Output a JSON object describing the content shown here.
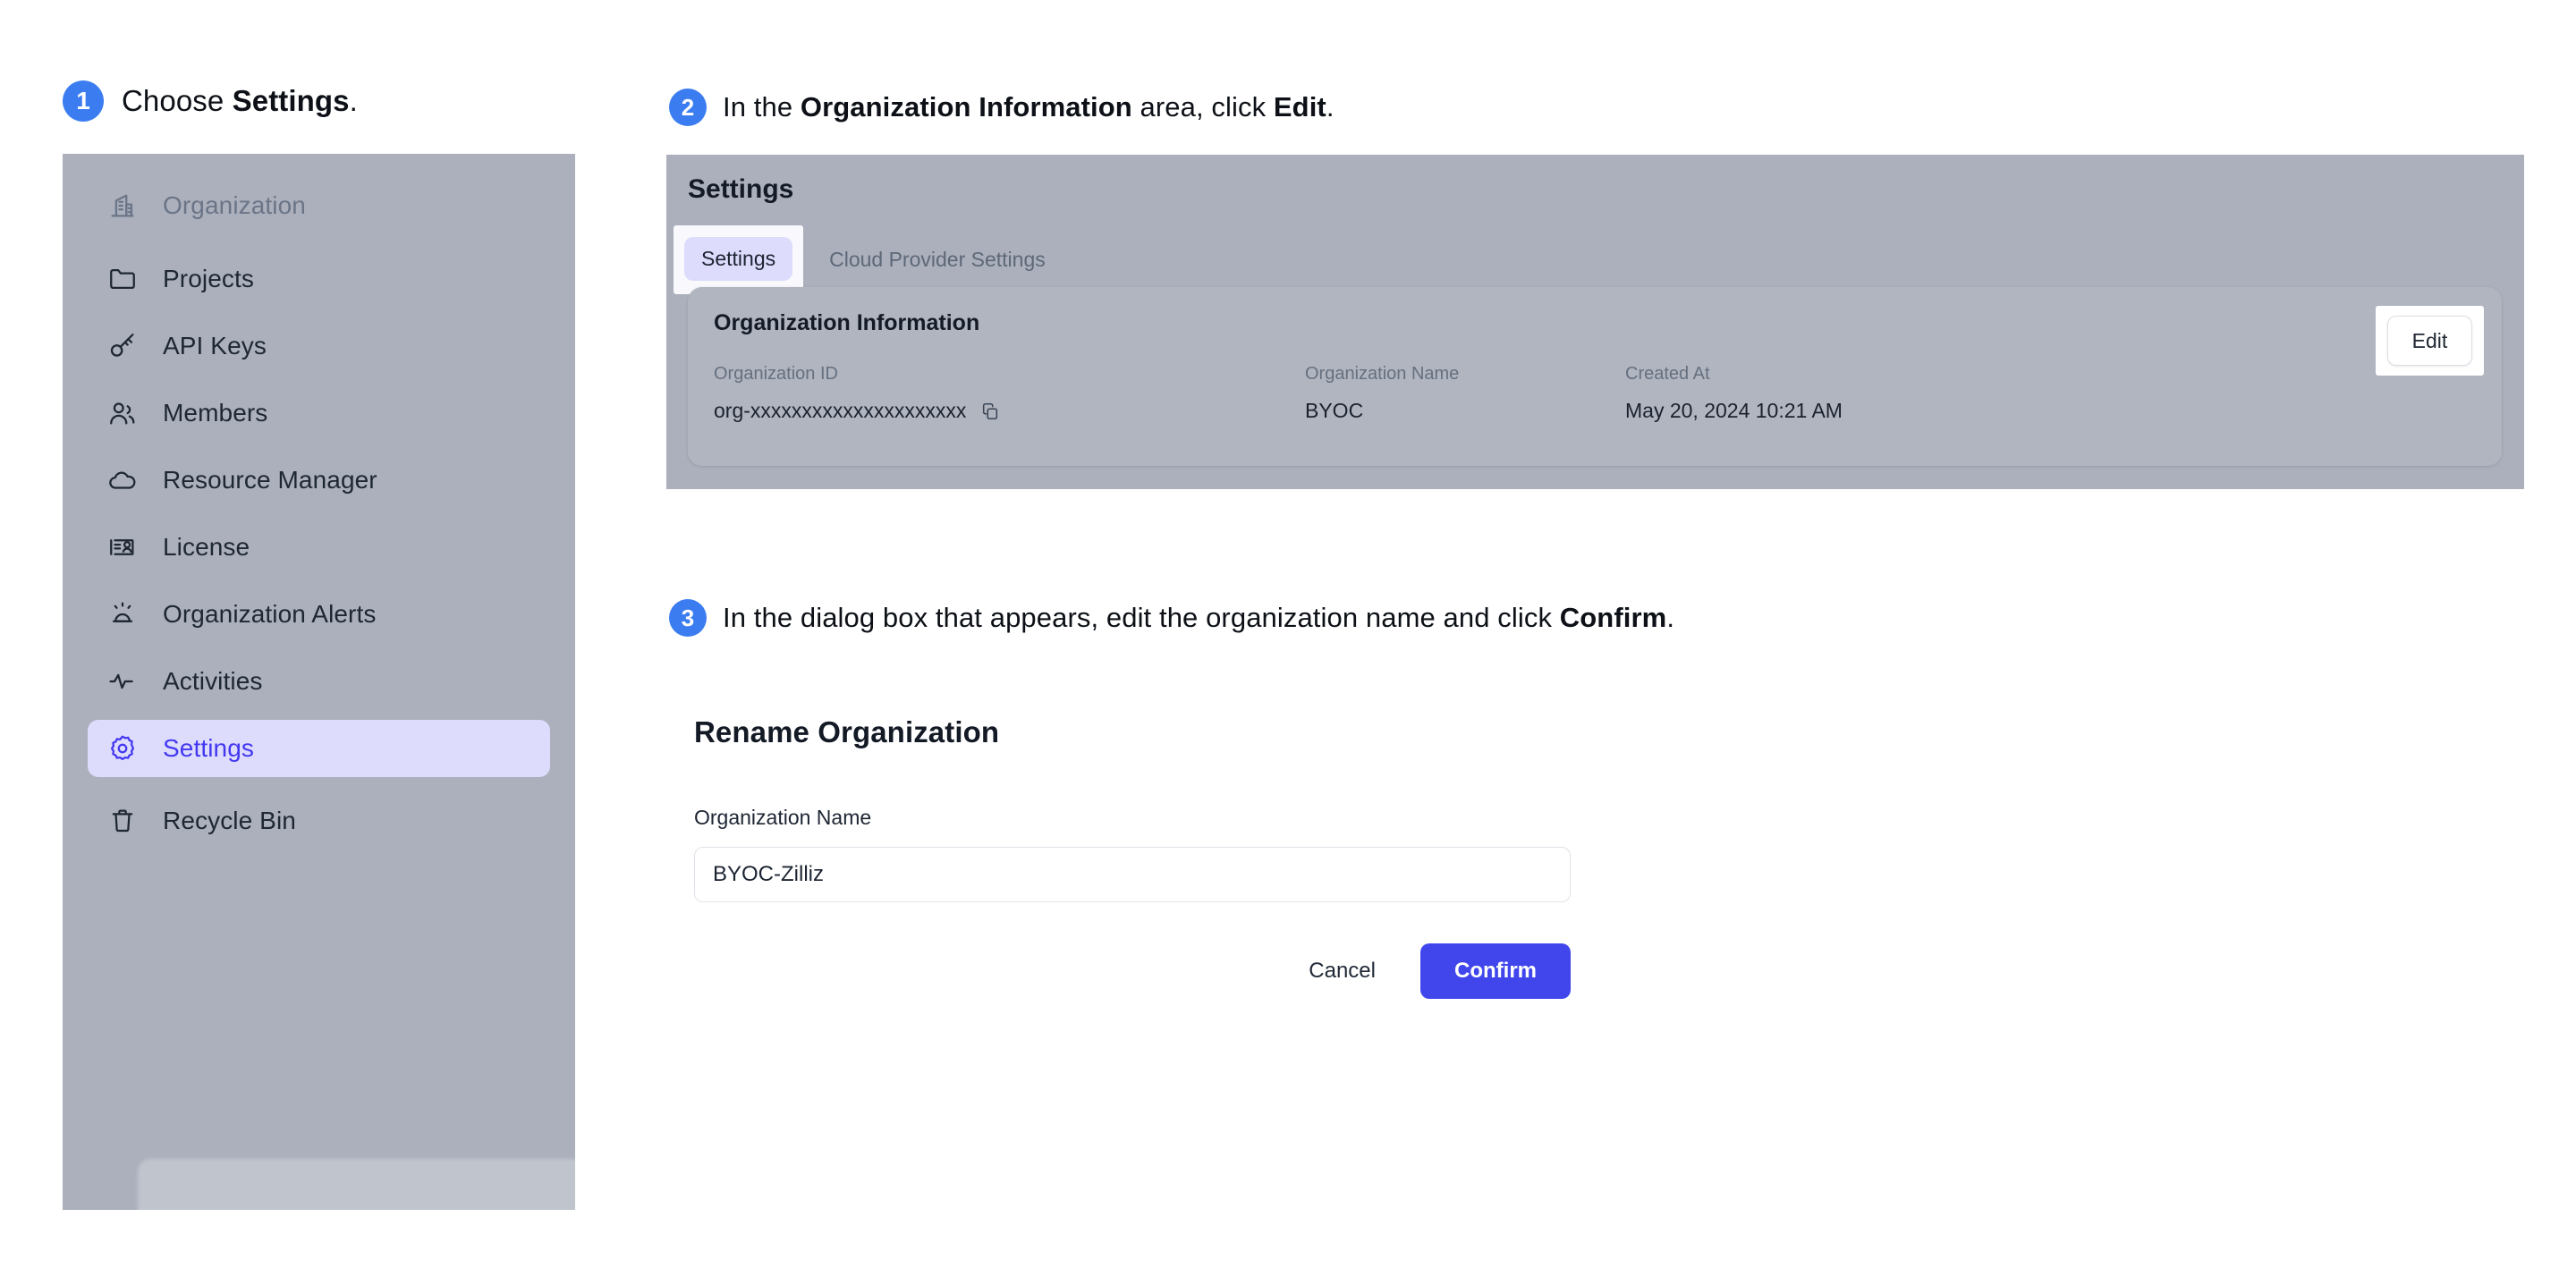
{
  "colors": {
    "step_badge": "#3b7df0",
    "accent_indigo": "#4046ec",
    "active_nav_bg": "#dddcfd",
    "panel_gray": "#abb0bc",
    "card_gray": "#b0b5c0"
  },
  "steps": [
    {
      "number": "1",
      "prefix": "Choose ",
      "strong": "Settings",
      "suffix": "."
    },
    {
      "number": "2",
      "prefix": "In the ",
      "strong": "Organization Information",
      "mid": " area, click ",
      "strong2": "Edit",
      "suffix": "."
    },
    {
      "number": "3",
      "prefix": "In the dialog box that appears, edit the organization name and click ",
      "strong": "Confirm",
      "suffix": "."
    }
  ],
  "sidebar": {
    "items": [
      {
        "label": "Organization",
        "icon": "building-icon",
        "state": "muted"
      },
      {
        "label": "Projects",
        "icon": "folder-icon",
        "state": "normal"
      },
      {
        "label": "API Keys",
        "icon": "key-icon",
        "state": "normal"
      },
      {
        "label": "Members",
        "icon": "users-icon",
        "state": "normal"
      },
      {
        "label": "Resource Manager",
        "icon": "cloud-icon",
        "state": "normal"
      },
      {
        "label": "License",
        "icon": "id-card-icon",
        "state": "normal"
      },
      {
        "label": "Organization Alerts",
        "icon": "alert-light-icon",
        "state": "normal"
      },
      {
        "label": "Activities",
        "icon": "activity-icon",
        "state": "normal"
      },
      {
        "label": "Settings",
        "icon": "gear-icon",
        "state": "active"
      },
      {
        "label": "Recycle Bin",
        "icon": "trash-icon",
        "state": "normal"
      }
    ]
  },
  "settings_panel": {
    "title": "Settings",
    "tabs": [
      {
        "label": "Settings",
        "active": true
      },
      {
        "label": "Cloud Provider Settings",
        "active": false
      }
    ],
    "card": {
      "title": "Organization Information",
      "edit_button": "Edit",
      "fields": [
        {
          "label": "Organization ID",
          "value": "org-xxxxxxxxxxxxxxxxxxxxx",
          "copy_icon": "copy-icon"
        },
        {
          "label": "Organization Name",
          "value": "BYOC"
        },
        {
          "label": "Created At",
          "value": "May 20, 2024 10:21 AM"
        }
      ]
    }
  },
  "dialog": {
    "title": "Rename Organization",
    "field_label": "Organization Name",
    "field_value": "BYOC-Zilliz",
    "field_placeholder": "Organization Name",
    "cancel_label": "Cancel",
    "confirm_label": "Confirm"
  }
}
